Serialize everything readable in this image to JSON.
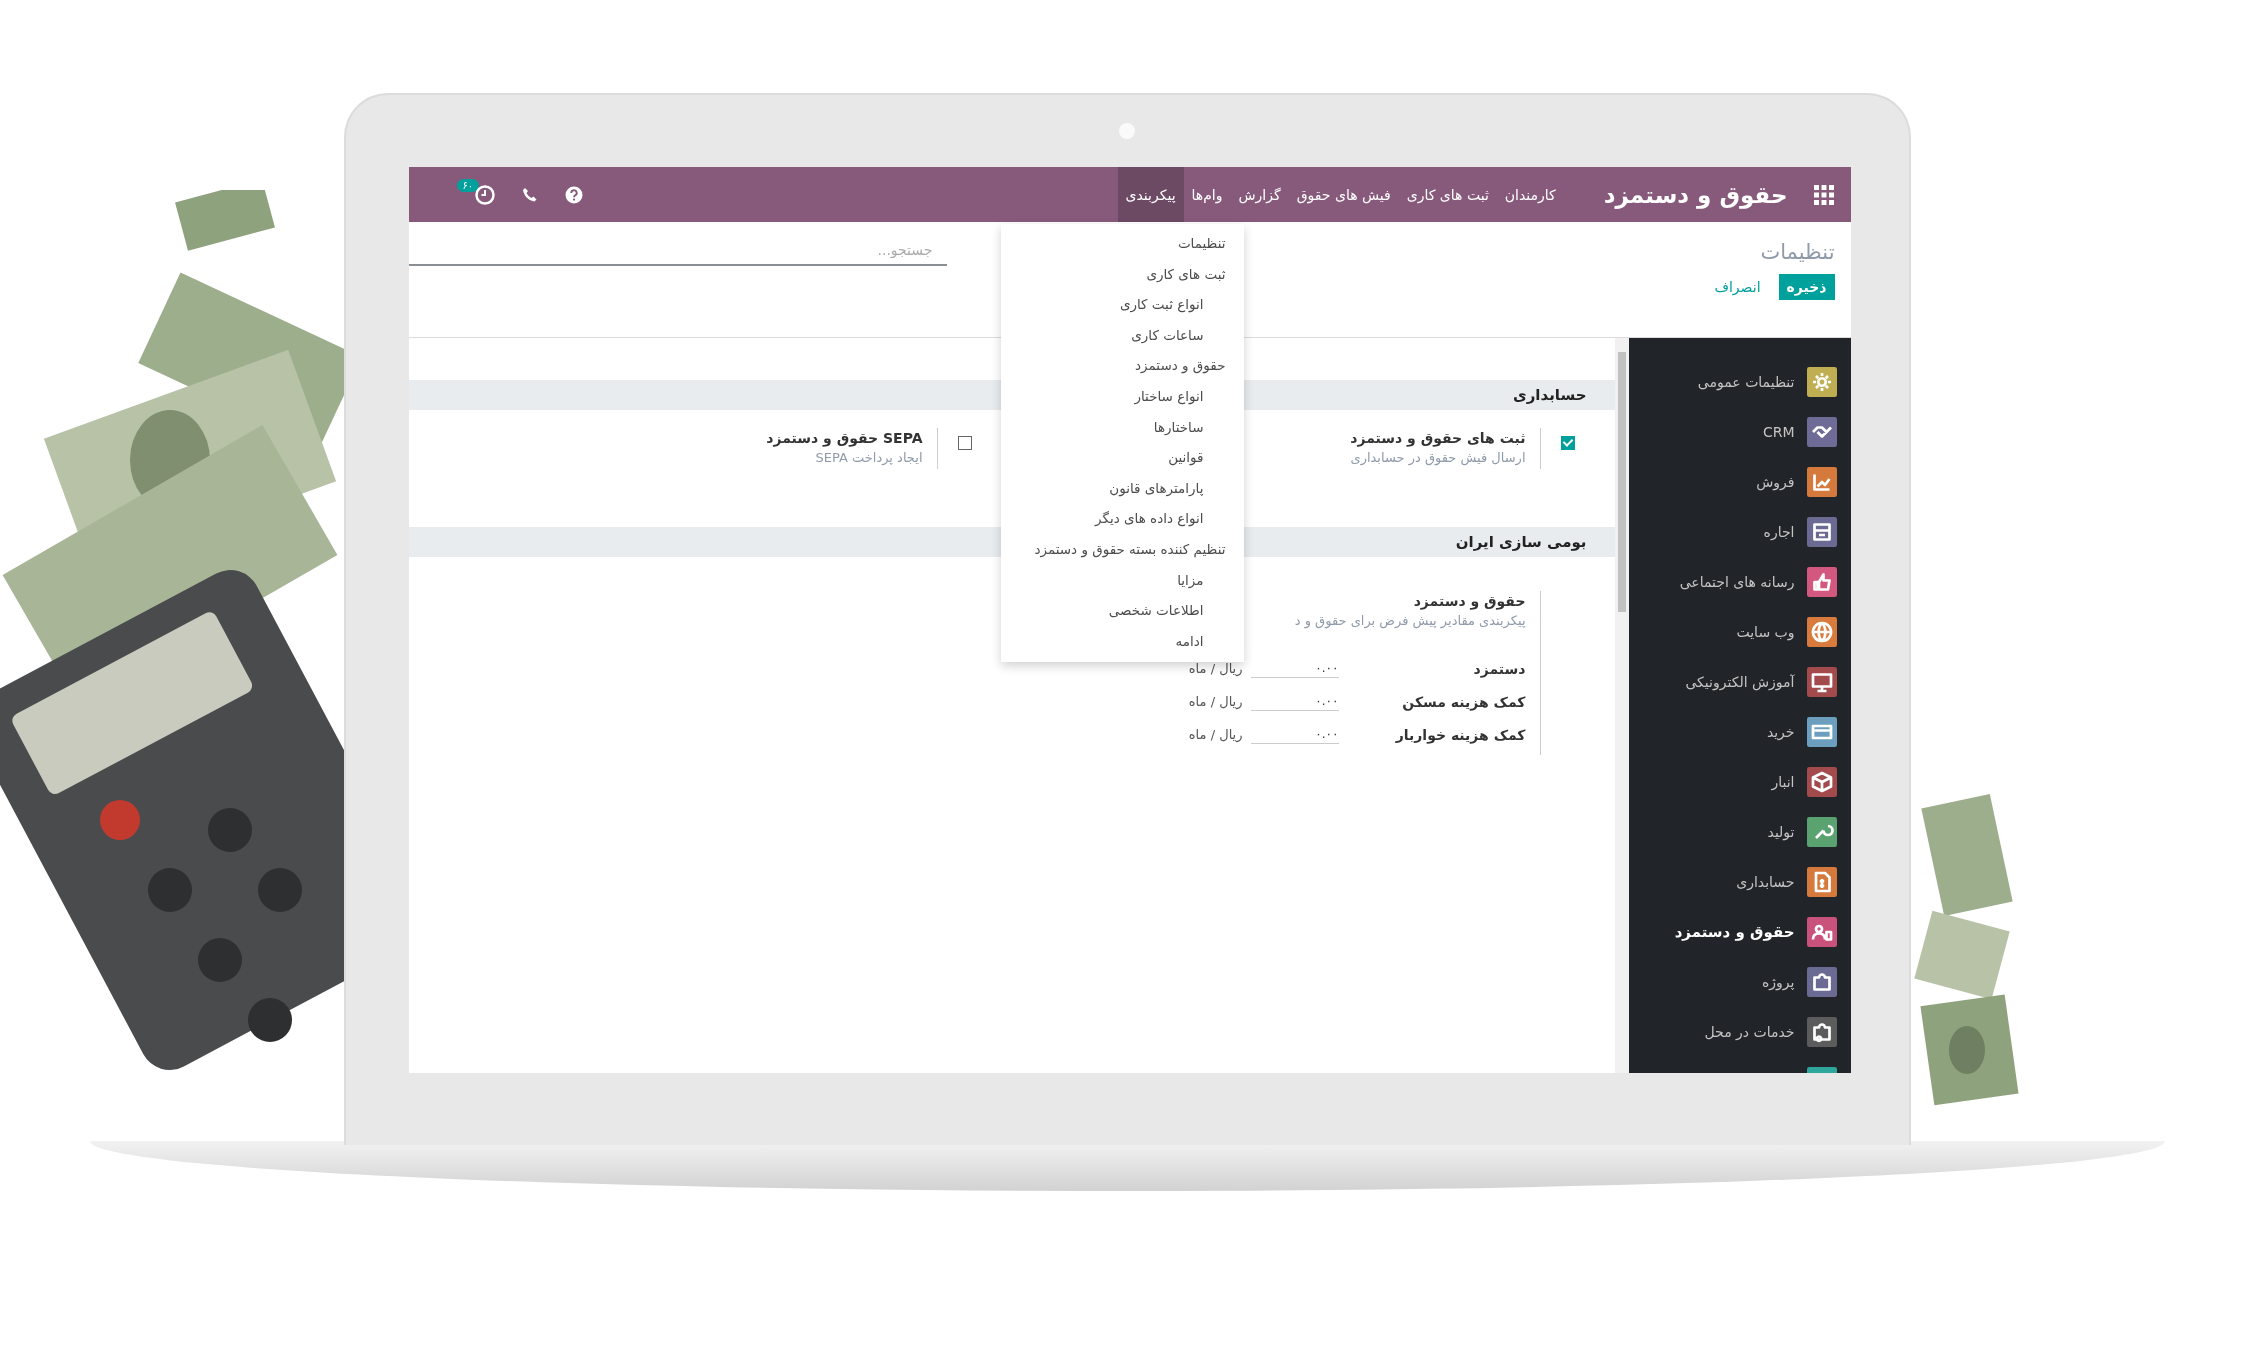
{
  "app": {
    "title": "حقوق و دستمزد"
  },
  "menu": [
    {
      "label": "کارمندان",
      "selected": false
    },
    {
      "label": "ثبت های کاری",
      "selected": false
    },
    {
      "label": "فیش های حقوق",
      "selected": false
    },
    {
      "label": "گزارش",
      "selected": false
    },
    {
      "label": "وام‌ها",
      "selected": false
    },
    {
      "label": "پیکربندی",
      "selected": true
    }
  ],
  "systray": {
    "activity_badge": "۶۰"
  },
  "dropdown": [
    {
      "label": "تنظیمات"
    },
    {
      "label": "ثبت های کاری",
      "children": [
        {
          "label": "انواع ثبت کاری"
        },
        {
          "label": "ساعات کاری"
        }
      ]
    },
    {
      "label": "حقوق و دستمزد",
      "children": [
        {
          "label": "انواع ساختار"
        },
        {
          "label": "ساختارها"
        },
        {
          "label": "قوانین"
        },
        {
          "label": "پارامترهای قانون"
        },
        {
          "label": "انواع داده های دیگر"
        }
      ]
    },
    {
      "label": "تنظیم کننده بسته حقوق و دستمزد",
      "children": [
        {
          "label": "مزایا"
        },
        {
          "label": "اطلاعات شخصی"
        },
        {
          "label": "ادامه"
        }
      ]
    }
  ],
  "control_panel": {
    "breadcrumb": "تنظیمات",
    "search": {
      "placeholder": "جستجو..."
    },
    "buttons": [
      {
        "label": "ذخیره",
        "kind": "primary"
      },
      {
        "label": "انصراف",
        "kind": "link"
      }
    ]
  },
  "sidebar": [
    {
      "label": "تنظیمات عمومی",
      "color": "#bfae52",
      "selected": false
    },
    {
      "label": "CRM",
      "color": "#6e6c96",
      "selected": false
    },
    {
      "label": "فروش",
      "color": "#d6793d",
      "selected": false
    },
    {
      "label": "اجاره",
      "color": "#6b6a92",
      "selected": false
    },
    {
      "label": "رسانه های اجتماعی",
      "color": "#d2587f",
      "selected": false
    },
    {
      "label": "وب سایت",
      "color": "#d97b3c",
      "selected": false
    },
    {
      "label": "آموزش الکترونیکی",
      "color": "#a34a4c",
      "selected": false
    },
    {
      "label": "خرید",
      "color": "#6b9fbd",
      "selected": false
    },
    {
      "label": "انبار",
      "color": "#a34a4c",
      "selected": false
    },
    {
      "label": "تولید",
      "color": "#5aa26f",
      "selected": false
    },
    {
      "label": "حسابداری",
      "color": "#d6793d",
      "selected": false
    },
    {
      "label": "حقوق و دستمزد",
      "color": "#c8527c",
      "selected": true
    },
    {
      "label": "پروژه",
      "color": "#6b6a92",
      "selected": false
    },
    {
      "label": "خدمات در محل",
      "color": "#5c5c5c",
      "selected": false
    },
    {
      "color": "#2ea69c",
      "selected": false
    }
  ],
  "sections": [
    {
      "title": "حسابداری",
      "settings": [
        {
          "kind": "checkbox",
          "label": "ثبت های حقوق و دستمزد",
          "description": "ارسال فیش حقوق در حسابداری",
          "checked": true
        },
        {
          "kind": "checkbox",
          "label": "SEPA حقوق و دستمزد",
          "description": "ایجاد پرداخت SEPA",
          "checked": false
        }
      ]
    },
    {
      "title": "بومی سازی ایران",
      "settings": [
        {
          "kind": "fields",
          "label": "حقوق و دستمزد",
          "description": "پیکربندی مقادیر پیش فرض برای حقوق و د",
          "fields": [
            {
              "label": "دستمزد",
              "value": "۰.۰۰",
              "unit": "ریال / ماه"
            },
            {
              "label": "کمک هزینه مسکن",
              "value": "۰.۰۰",
              "unit": "ریال / ماه"
            },
            {
              "label": "کمک هزینه خواربار",
              "value": "۰.۰۰",
              "unit": "ریال / ماه"
            }
          ]
        }
      ]
    }
  ]
}
